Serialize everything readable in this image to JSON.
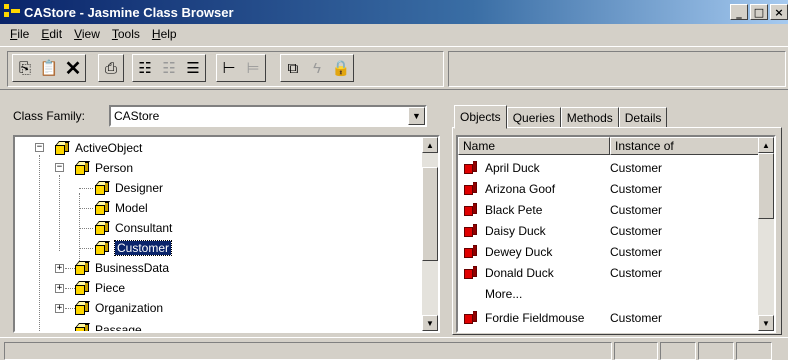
{
  "window": {
    "title": "CAStore - Jasmine Class Browser",
    "minimize": "_",
    "maximize": "□",
    "close": "×"
  },
  "menu": [
    {
      "key": "F",
      "rest": "ile"
    },
    {
      "key": "E",
      "rest": "dit"
    },
    {
      "key": "V",
      "rest": "iew"
    },
    {
      "key": "T",
      "rest": "ools"
    },
    {
      "key": "H",
      "rest": "elp"
    }
  ],
  "toolbar": {
    "copy": "⎘",
    "paste": "📋",
    "delete": "✕",
    "print": "⎙",
    "tree1": "☷",
    "tree2": "☷",
    "tree3": "☰",
    "inherit": "⊢",
    "subclass": "⊨",
    "new_window": "⧉",
    "method": "ϟ",
    "lock": "🔒"
  },
  "class_family": {
    "label": "Class Family:",
    "value": "CAStore"
  },
  "tree": [
    {
      "label": "ActiveObject",
      "expander": "−"
    },
    {
      "label": "Person",
      "expander": "−"
    },
    {
      "label": "Designer"
    },
    {
      "label": "Model"
    },
    {
      "label": "Consultant"
    },
    {
      "label": "Customer",
      "selected": true
    },
    {
      "label": "BusinessData",
      "expander": "+"
    },
    {
      "label": "Piece",
      "expander": "+"
    },
    {
      "label": "Organization",
      "expander": "+"
    },
    {
      "label": "Passage"
    }
  ],
  "tabs": [
    "Objects",
    "Queries",
    "Methods",
    "Details"
  ],
  "objects_list": {
    "columns": [
      "Name",
      "Instance of"
    ],
    "rows": [
      {
        "name": "April Duck",
        "instance": "Customer"
      },
      {
        "name": "Arizona Goof",
        "instance": "Customer"
      },
      {
        "name": "Black Pete",
        "instance": "Customer"
      },
      {
        "name": "Daisy Duck",
        "instance": "Customer"
      },
      {
        "name": "Dewey Duck",
        "instance": "Customer"
      },
      {
        "name": "Donald Duck",
        "instance": "Customer"
      },
      {
        "name": "More...",
        "instance": ""
      },
      {
        "name": "Fordie Fieldmouse",
        "instance": "Customer"
      }
    ]
  },
  "colors": {
    "title_start": "#0a246a",
    "title_end": "#a6caf0",
    "face": "#d4d0c8",
    "selection": "#0a246a",
    "class_icon": "#ffd700",
    "object_icon": "#e00000"
  }
}
